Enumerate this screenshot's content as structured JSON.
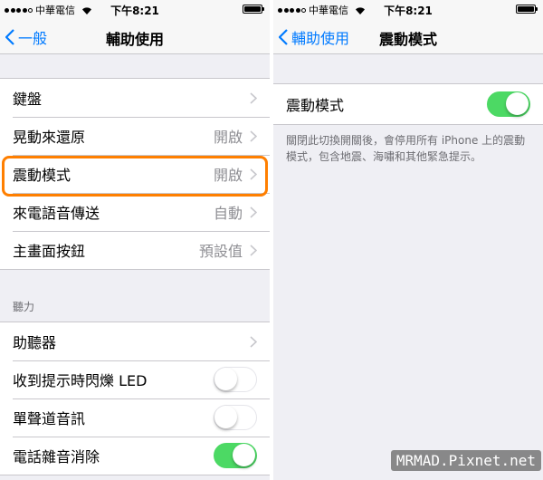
{
  "status": {
    "carrier": "中華電信",
    "time": "下午8:21"
  },
  "left": {
    "back_label": "一般",
    "title": "輔助使用",
    "rows": [
      {
        "label": "鍵盤",
        "value": ""
      },
      {
        "label": "晃動來還原",
        "value": "開啟"
      },
      {
        "label": "震動模式",
        "value": "開啟"
      },
      {
        "label": "來電語音傳送",
        "value": "自動"
      },
      {
        "label": "主畫面按鈕",
        "value": "預設值"
      }
    ],
    "hearing_header": "聽力",
    "hearing": [
      {
        "label": "助聽器",
        "type": "arrow"
      },
      {
        "label": "收到提示時閃爍 LED",
        "type": "toggle",
        "on": false
      },
      {
        "label": "單聲道音訊",
        "type": "toggle",
        "on": false
      },
      {
        "label": "電話雜音消除",
        "type": "toggle",
        "on": true
      }
    ]
  },
  "right": {
    "back_label": "輔助使用",
    "title": "震動模式",
    "toggle_label": "震動模式",
    "toggle_on": true,
    "footer": "關閉此切換開關後，會停用所有 iPhone 上的震動模式，包含地震、海嘯和其他緊急提示。"
  },
  "watermark": "MRMAD.Pixnet.net",
  "colors": {
    "accent": "#007aff",
    "switch_on": "#4cd964",
    "highlight": "#ff7f00"
  }
}
